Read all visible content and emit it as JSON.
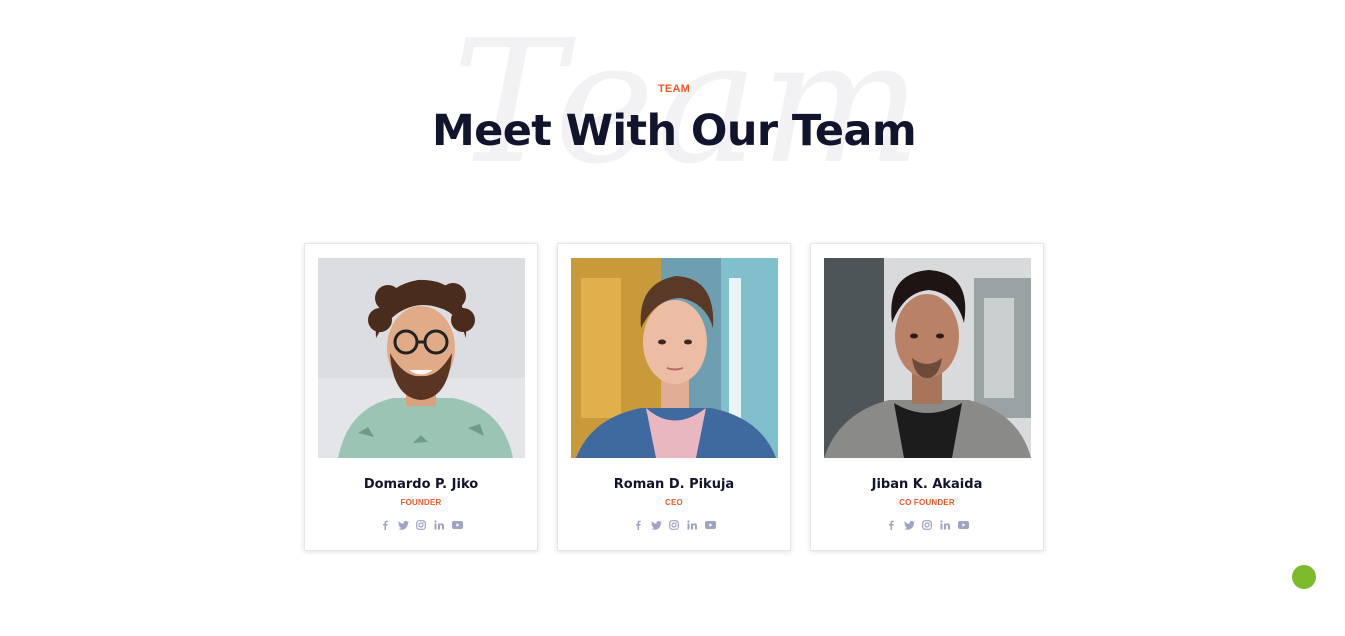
{
  "section": {
    "bg_word": "Team",
    "eyebrow": "TEAM",
    "title": "Meet With Our Team"
  },
  "members": [
    {
      "name": "Domardo P. Jiko",
      "role": "FOUNDER",
      "socials": [
        "facebook-icon",
        "twitter-icon",
        "instagram-icon",
        "linkedin-icon",
        "youtube-icon"
      ]
    },
    {
      "name": "Roman D. Pikuja",
      "role": "CEO",
      "socials": [
        "facebook-icon",
        "twitter-icon",
        "instagram-icon",
        "linkedin-icon",
        "youtube-icon"
      ]
    },
    {
      "name": "Jiban K. Akaida",
      "role": "CO FOUNDER",
      "socials": [
        "facebook-icon",
        "twitter-icon",
        "instagram-icon",
        "linkedin-icon",
        "youtube-icon"
      ]
    }
  ],
  "colors": {
    "accent": "#f05a28",
    "heading": "#11142d",
    "icon": "#9fa3c4",
    "float_button": "#7dbb2d"
  }
}
